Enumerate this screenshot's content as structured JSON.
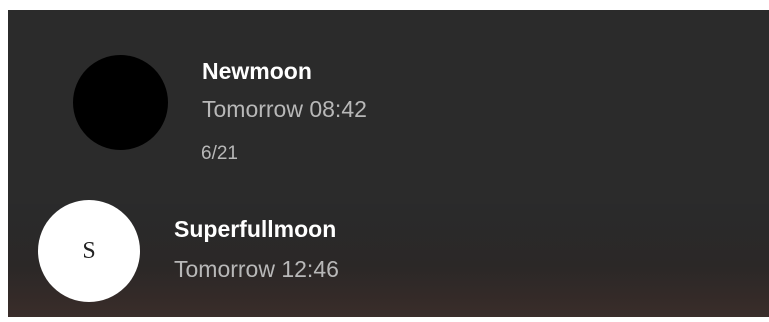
{
  "notifications": [
    {
      "title": "Newmoon",
      "time": "Tomorrow 08:42",
      "date": "6/21",
      "avatar_color": "#000000"
    },
    {
      "title": "Superfullmoon",
      "time": "Tomorrow 12:46",
      "avatar_letter": "S",
      "avatar_color": "#ffffff"
    }
  ],
  "colors": {
    "background": "#2b2b2b",
    "title_text": "#ffffff",
    "secondary_text": "#b8b8b8"
  }
}
